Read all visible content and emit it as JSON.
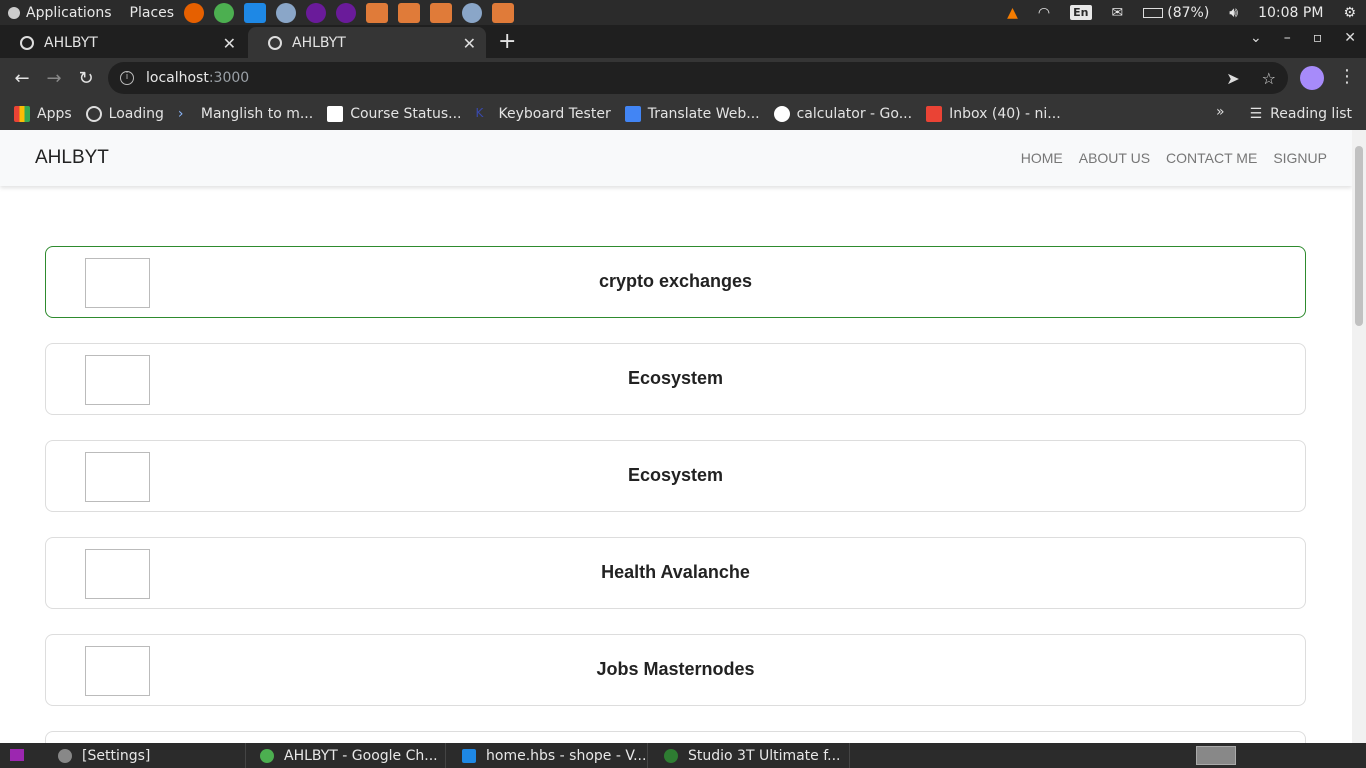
{
  "system_panel": {
    "applications": "Applications",
    "places": "Places",
    "battery": "(87%)",
    "language": "En",
    "time": "10:08 PM"
  },
  "tabs": [
    {
      "label": "AHLBYT"
    },
    {
      "label": "AHLBYT"
    }
  ],
  "address": {
    "host": "localhost",
    "port": ":3000"
  },
  "bookmarks": [
    {
      "label": "Apps"
    },
    {
      "label": "Loading"
    },
    {
      "label": "Manglish to m..."
    },
    {
      "label": "Course Status..."
    },
    {
      "label": "Keyboard Tester"
    },
    {
      "label": "Translate Web..."
    },
    {
      "label": "calculator - Go..."
    },
    {
      "label": "Inbox (40) - ni..."
    }
  ],
  "reading_list": "Reading list",
  "site": {
    "brand": "AHLBYT",
    "nav": [
      "HOME",
      "ABOUT US",
      "CONTACT ME",
      "SIGNUP"
    ]
  },
  "cards": [
    {
      "title": "crypto exchanges",
      "active": true
    },
    {
      "title": "Ecosystem"
    },
    {
      "title": "Ecosystem"
    },
    {
      "title": "Health Avalanche"
    },
    {
      "title": "Jobs Masternodes"
    }
  ],
  "taskbar": [
    {
      "label": "[Settings]"
    },
    {
      "label": "AHLBYT - Google Ch..."
    },
    {
      "label": "home.hbs - shope - V..."
    },
    {
      "label": "Studio 3T Ultimate f..."
    }
  ],
  "colors": {
    "active_card_border": "#2e8b2e",
    "panel_bg": "#2b2b2b",
    "chrome_bg": "#353535"
  }
}
